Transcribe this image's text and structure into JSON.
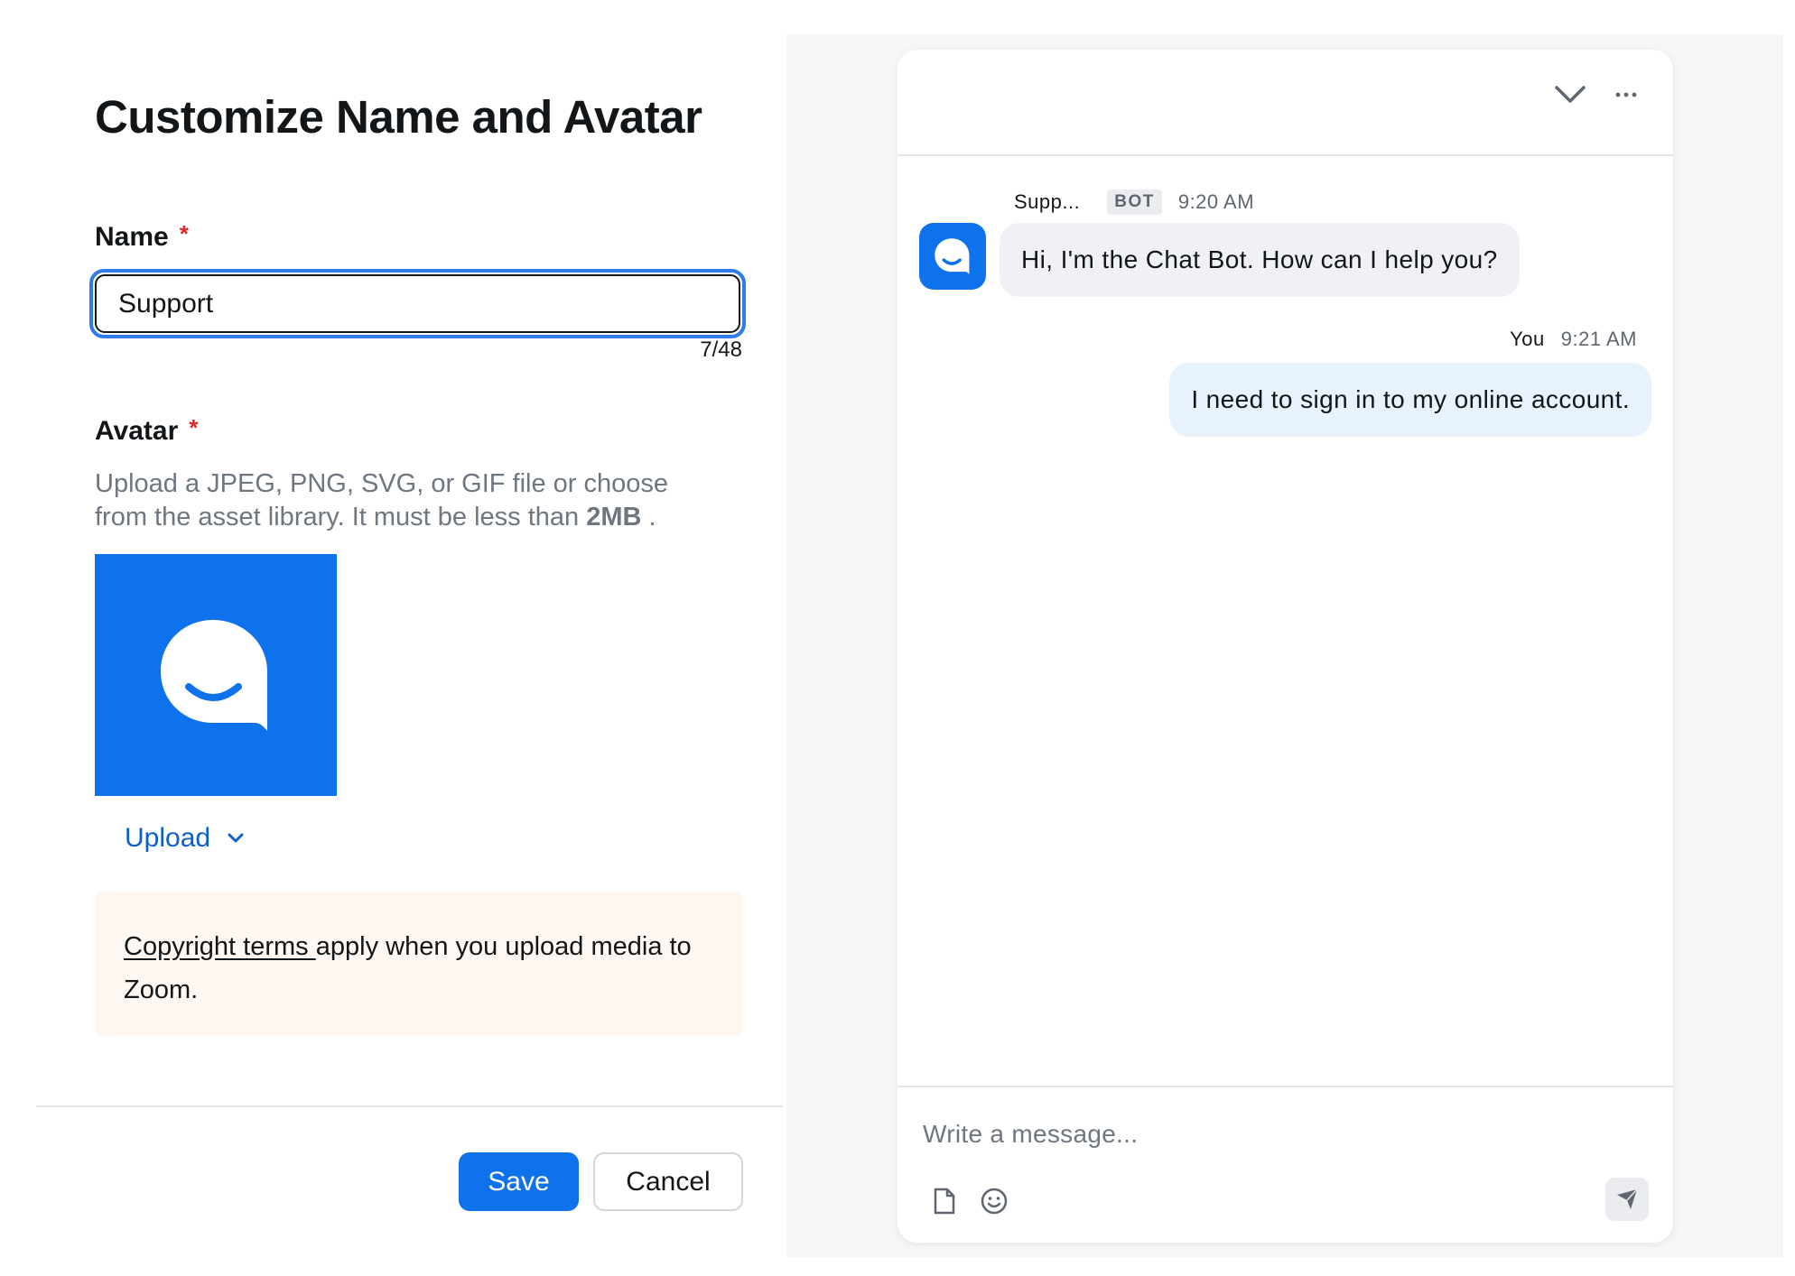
{
  "form": {
    "title": "Customize Name and Avatar",
    "name_label": "Name",
    "required_mark": "*",
    "name_value": "Support",
    "char_count": "7/48",
    "avatar_label": "Avatar",
    "avatar_desc_text": "Upload a JPEG, PNG, SVG, or GIF file or choose from the asset library. It must be less than ",
    "avatar_desc_limit": "2MB",
    "avatar_desc_end": " .",
    "avatar_icon": "chat-bubble-smile-icon",
    "upload_label": "Upload",
    "copyright_link": "Copyright terms ",
    "copyright_text": "apply when you upload media to Zoom.",
    "save_label": "Save",
    "cancel_label": "Cancel"
  },
  "chat": {
    "header_icons": [
      "chevron-down-icon",
      "more-icon"
    ],
    "messages": [
      {
        "sender": "Supp...",
        "badge": "BOT",
        "time": "9:20 AM",
        "text": "Hi, I'm the Chat Bot. How can I help you?"
      },
      {
        "sender": "You",
        "time": "9:21 AM",
        "text": "I need to sign in to my online account."
      }
    ],
    "composer_placeholder": "Write a message...",
    "composer_icons": [
      "file-icon",
      "emoji-icon",
      "send-icon"
    ]
  },
  "colors": {
    "accent": "#0e72ed",
    "required": "#e02828",
    "link": "#0e5fc9",
    "copyright_bg": "#fff8f2",
    "user_bubble": "#e8f2fd",
    "bot_bubble": "#f0f1f4"
  }
}
